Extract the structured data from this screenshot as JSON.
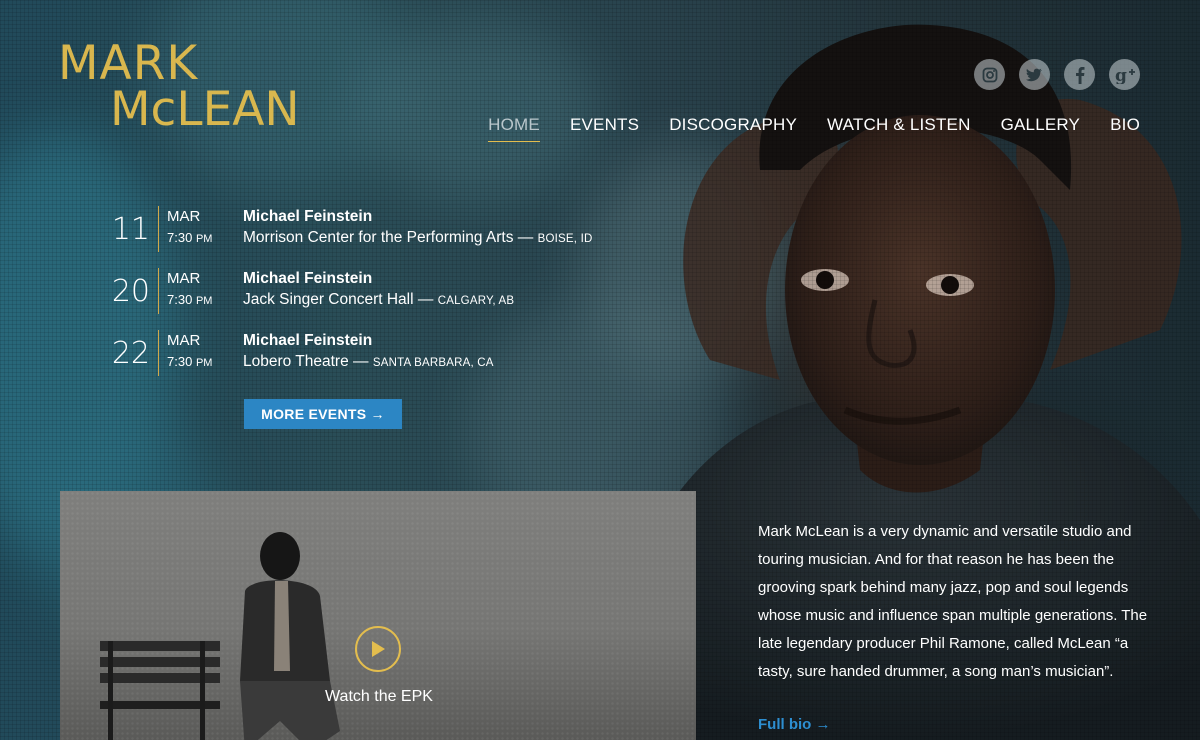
{
  "logo": {
    "line1": "MARK",
    "line2": "McLEAN"
  },
  "social": [
    {
      "icon": "instagram-icon"
    },
    {
      "icon": "twitter-icon"
    },
    {
      "icon": "facebook-icon"
    },
    {
      "icon": "google-plus-icon"
    }
  ],
  "nav": {
    "items": [
      {
        "label": "HOME",
        "active": true
      },
      {
        "label": "EVENTS"
      },
      {
        "label": "DISCOGRAPHY"
      },
      {
        "label": "WATCH & LISTEN"
      },
      {
        "label": "GALLERY"
      },
      {
        "label": "BIO"
      }
    ]
  },
  "events": [
    {
      "day": "11",
      "month": "MAR",
      "time": "7:30",
      "ampm": "PM",
      "artist": "Michael Feinstein",
      "venue": "Morrison Center for the Performing Arts",
      "city": "BOISE, ID"
    },
    {
      "day": "20",
      "month": "MAR",
      "time": "7:30",
      "ampm": "PM",
      "artist": "Michael Feinstein",
      "venue": "Jack Singer Concert Hall",
      "city": "CALGARY, AB"
    },
    {
      "day": "22",
      "month": "MAR",
      "time": "7:30",
      "ampm": "PM",
      "artist": "Michael Feinstein",
      "venue": "Lobero Theatre",
      "city": "SANTA BARBARA, CA"
    }
  ],
  "more_events": {
    "label": "MORE EVENTS →"
  },
  "video": {
    "label": "Watch the EPK"
  },
  "bio": {
    "text": "Mark McLean is a very dynamic and versatile studio and touring musician.  And for that reason he has been the grooving spark behind many jazz, pop and soul legends whose music and influence span multiple generations.  The late legendary producer Phil Ramone, called McLean “a tasty, sure handed drummer, a song man’s musician”.",
    "link_label": "Full bio →"
  },
  "colors": {
    "gold": "#e3bd4e",
    "button_blue": "#2c86c4",
    "link_blue": "#2d8ed0"
  }
}
